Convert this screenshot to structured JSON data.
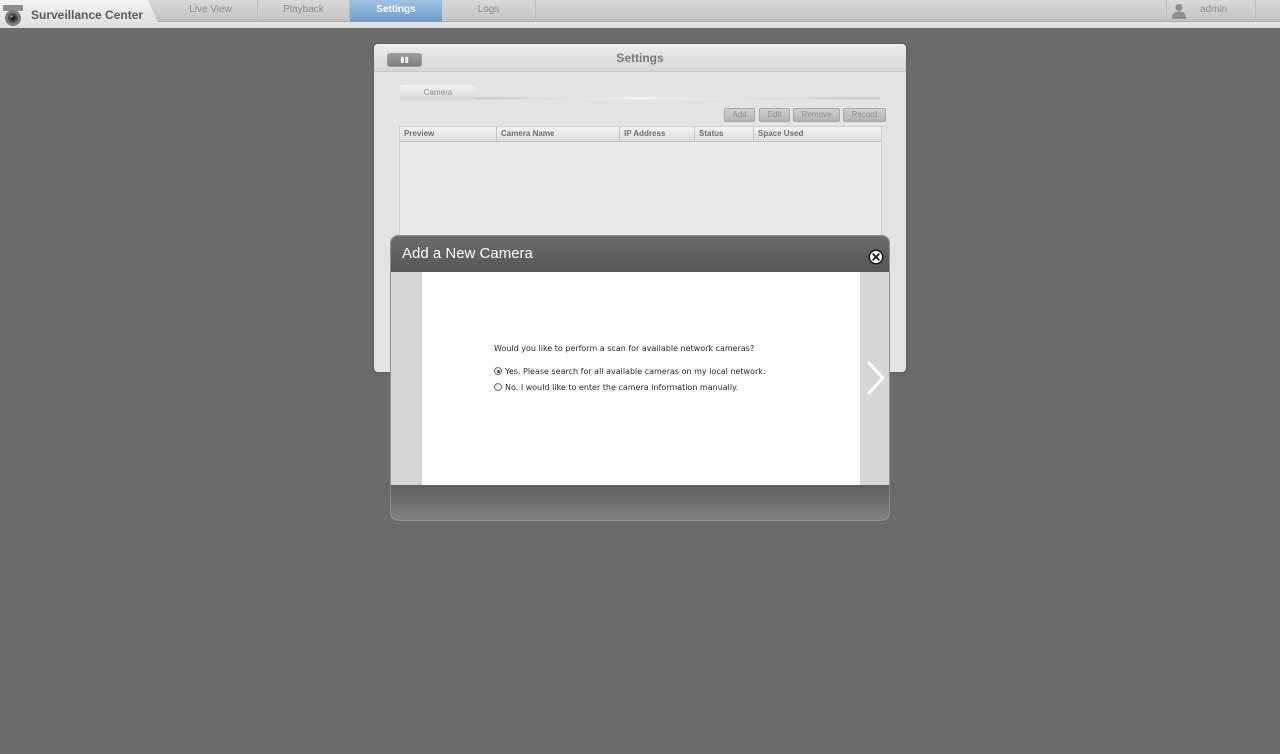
{
  "app": {
    "title": "Surveillance Center",
    "nav": [
      {
        "label": "Live View",
        "active": false
      },
      {
        "label": "Playback",
        "active": false
      },
      {
        "label": "Settings",
        "active": true
      },
      {
        "label": "Logs",
        "active": false
      }
    ],
    "user": {
      "name": "admin",
      "icon": "user-icon"
    },
    "logo_icon": "camera-logo-icon",
    "accent_color": "#6a9dca"
  },
  "settings": {
    "title": "Settings",
    "sub_tab": "Camera",
    "actions": [
      "Add",
      "Edit",
      "Remove",
      "Record"
    ],
    "table": {
      "columns": [
        "Preview",
        "Camera Name",
        "IP Address",
        "Status",
        "Space Used"
      ],
      "rows": []
    }
  },
  "modal": {
    "title": "Add a New Camera",
    "close_icon": "close-circle-icon",
    "next_icon": "chevron-right-icon",
    "question": "Would you like to perform a scan for available network cameras?",
    "options": [
      {
        "label": "Yes. Please search for all available cameras on my local network.",
        "selected": true
      },
      {
        "label": "No. I would like to enter the camera information manually.",
        "selected": false
      }
    ]
  }
}
